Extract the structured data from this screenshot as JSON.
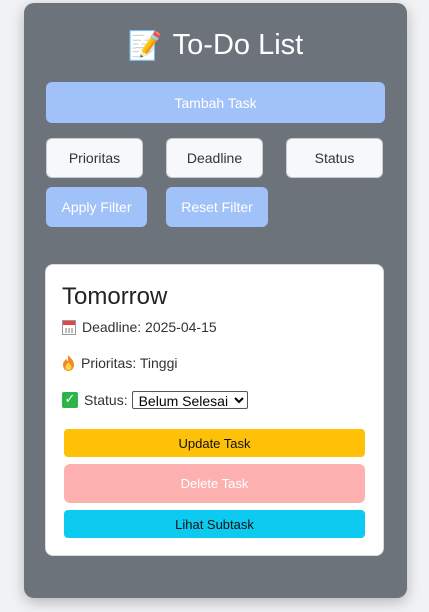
{
  "header": {
    "icon": "memo-icon",
    "title": "To-Do List"
  },
  "toolbar": {
    "add_task_label": "Tambah Task",
    "filters": {
      "priority_label": "Prioritas",
      "deadline_label": "Deadline",
      "status_label": "Status"
    },
    "apply_filter_label": "Apply Filter",
    "reset_filter_label": "Reset Filter"
  },
  "task": {
    "title": "Tomorrow",
    "deadline_text": "Deadline: 2025-04-15",
    "priority_text": "Prioritas: Tinggi",
    "status_label": "Status:",
    "status_selected": "Belum Selesai",
    "update_label": "Update Task",
    "delete_label": "Delete Task",
    "subtask_label": "Lihat Subtask"
  },
  "colors": {
    "panel": "#6c737b",
    "primary_button": "#a1c2f8",
    "update": "#ffc107",
    "delete": "#fdb0b0",
    "subtask": "#0dcaf0"
  }
}
